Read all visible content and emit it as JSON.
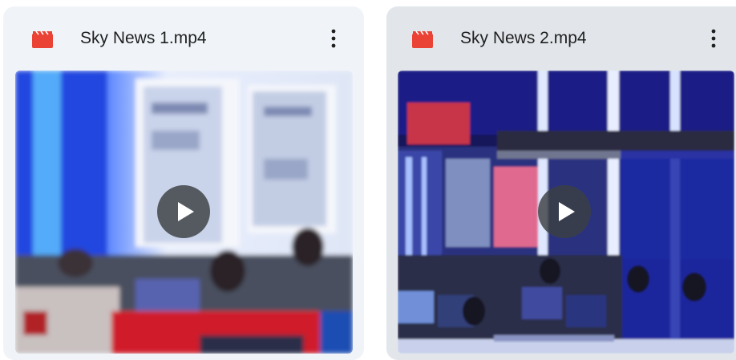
{
  "files": [
    {
      "name": "Sky News 1.mp4",
      "type_icon": "video-file-icon",
      "menu_icon": "more-vert-icon",
      "thumbnail_icon": "play-icon"
    },
    {
      "name": "Sky News 2.mp4",
      "type_icon": "video-file-icon",
      "menu_icon": "more-vert-icon",
      "thumbnail_icon": "play-icon"
    }
  ],
  "colors": {
    "video_icon": "#ea4335",
    "card_default": "#f0f4f9",
    "card_hover": "#e2e6eb"
  }
}
